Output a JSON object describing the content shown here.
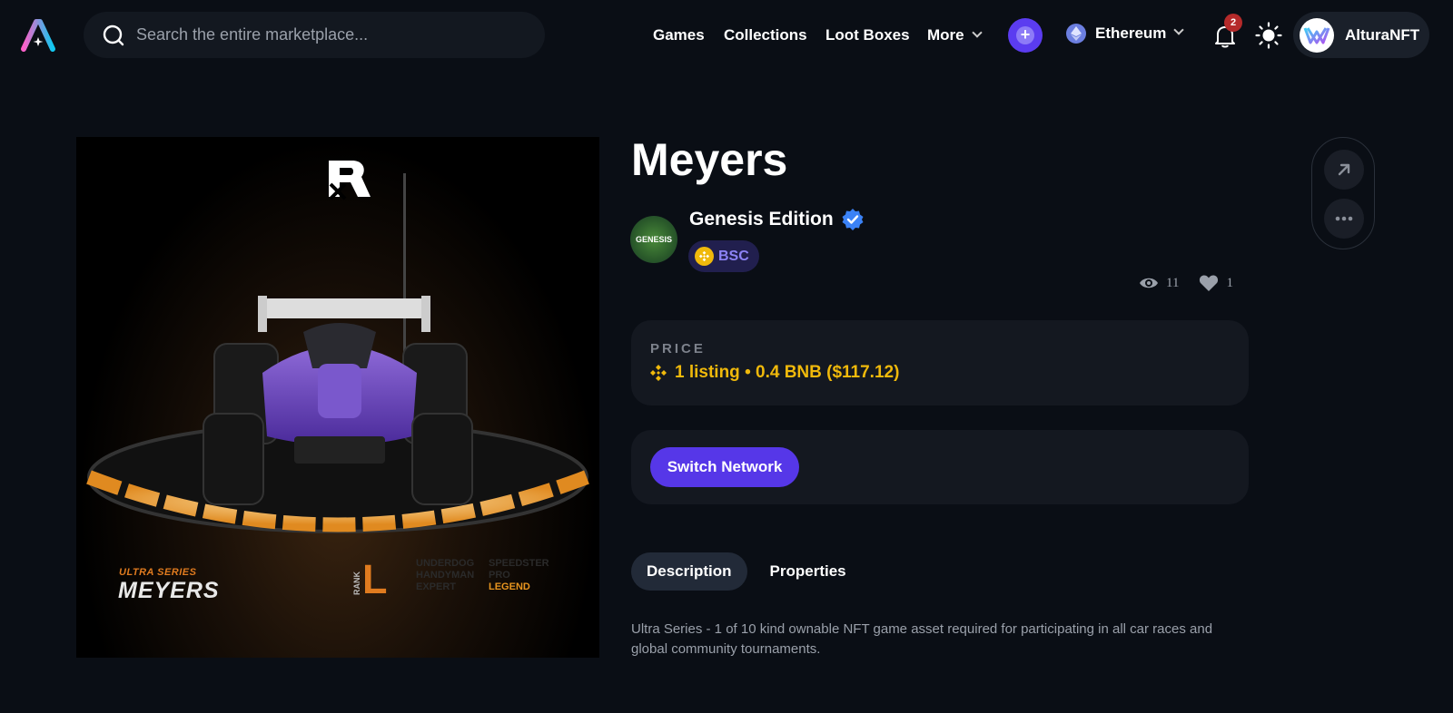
{
  "header": {
    "search_placeholder": "Search the entire marketplace...",
    "nav": [
      {
        "label": "Games"
      },
      {
        "label": "Collections"
      },
      {
        "label": "Loot Boxes"
      },
      {
        "label": "More"
      }
    ],
    "network": "Ethereum",
    "notification_count": "2",
    "username": "AlturaNFT"
  },
  "nft": {
    "image_text": {
      "series": "ULTRA SERIES",
      "name": "MEYERS",
      "rank_word": "RANK",
      "rank_letter": "L",
      "rank_col1": [
        "UNDERDOG",
        "HANDYMAN",
        "EXPERT"
      ],
      "rank_col2": [
        "SPEEDSTER",
        "PRO",
        "LEGEND"
      ],
      "active_rank": "LEGEND"
    },
    "title": "Meyers",
    "collection": {
      "name": "Genesis Edition",
      "avatar_text": "GENESIS",
      "verified": true,
      "chain": "BSC"
    },
    "views": "11",
    "likes": "1"
  },
  "price": {
    "label": "PRICE",
    "value": "1 listing • 0.4 BNB ($117.12)"
  },
  "network_card": {
    "button": "Switch Network"
  },
  "tabs": [
    {
      "label": "Description",
      "active": true
    },
    {
      "label": "Properties",
      "active": false
    }
  ],
  "description": "Ultra Series - 1 of 10 kind ownable NFT game asset required for participating in all car races and global community tournaments.",
  "colors": {
    "accent": "#5637e8",
    "price": "#f0b90b",
    "chain_badge_text": "#8c83f5",
    "background": "#0a0e15"
  }
}
